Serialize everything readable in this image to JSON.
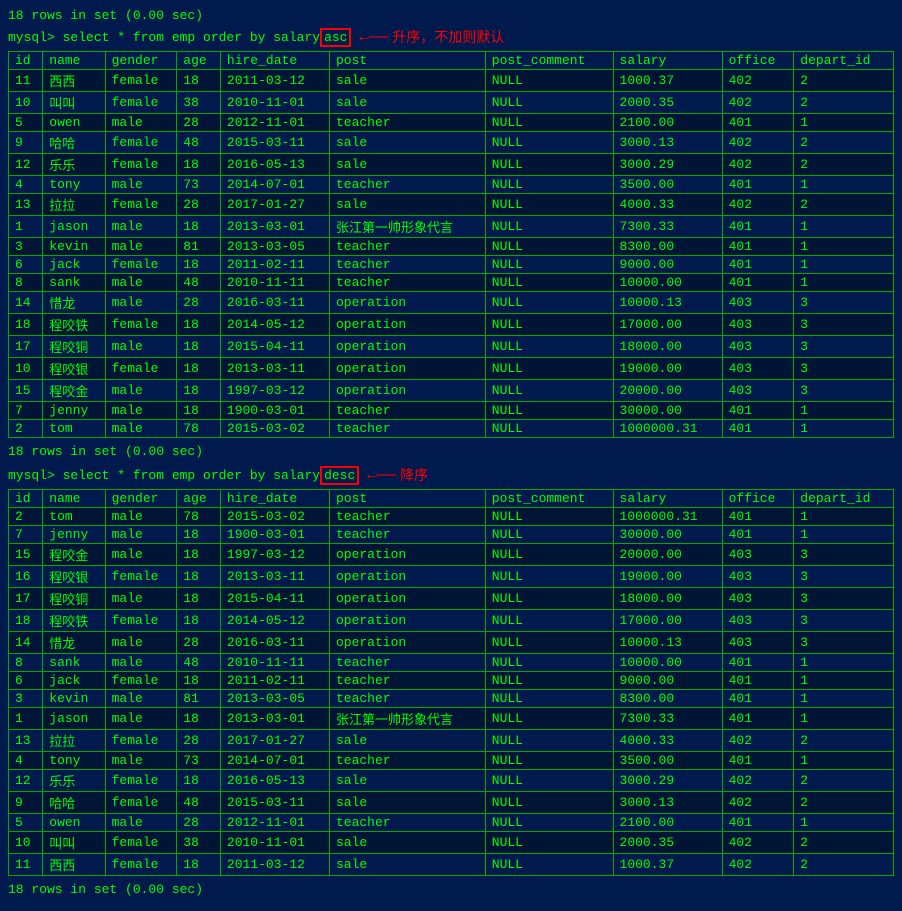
{
  "lines": {
    "rows_asc": "18 rows in set (0.00 sec)",
    "rows_desc": "18 rows in set (0.00 sec)",
    "rows_end": "18 rows in set (0.00 sec)",
    "cmd_asc": "mysql> select * from emp order by salary",
    "cmd_desc": "mysql> select * from emp order by salary",
    "asc_keyword": "asc",
    "desc_keyword": "desc",
    "asc_annotation": "升序，不加则默认",
    "desc_annotation": "降序"
  },
  "columns": [
    "id",
    "name",
    "gender",
    "age",
    "hire_date",
    "post",
    "post_comment",
    "salary",
    "office",
    "depart_id"
  ],
  "asc_rows": [
    [
      "11",
      "西西",
      "female",
      "18",
      "2011-03-12",
      "sale",
      "NULL",
      "1000.37",
      "402",
      "2"
    ],
    [
      "10",
      "叫叫",
      "female",
      "38",
      "2010-11-01",
      "sale",
      "NULL",
      "2000.35",
      "402",
      "2"
    ],
    [
      "5",
      "owen",
      "male",
      "28",
      "2012-11-01",
      "teacher",
      "NULL",
      "2100.00",
      "401",
      "1"
    ],
    [
      "9",
      "哈哈",
      "female",
      "48",
      "2015-03-11",
      "sale",
      "NULL",
      "3000.13",
      "402",
      "2"
    ],
    [
      "12",
      "乐乐",
      "female",
      "18",
      "2016-05-13",
      "sale",
      "NULL",
      "3000.29",
      "402",
      "2"
    ],
    [
      "4",
      "tony",
      "male",
      "73",
      "2014-07-01",
      "teacher",
      "NULL",
      "3500.00",
      "401",
      "1"
    ],
    [
      "13",
      "拉拉",
      "female",
      "28",
      "2017-01-27",
      "sale",
      "NULL",
      "4000.33",
      "402",
      "2"
    ],
    [
      "1",
      "jason",
      "male",
      "18",
      "2013-03-01",
      "张江第一帅形象代言",
      "NULL",
      "7300.33",
      "401",
      "1"
    ],
    [
      "3",
      "kevin",
      "male",
      "81",
      "2013-03-05",
      "teacher",
      "NULL",
      "8300.00",
      "401",
      "1"
    ],
    [
      "6",
      "jack",
      "female",
      "18",
      "2011-02-11",
      "teacher",
      "NULL",
      "9000.00",
      "401",
      "1"
    ],
    [
      "8",
      "sank",
      "male",
      "48",
      "2010-11-11",
      "teacher",
      "NULL",
      "10000.00",
      "401",
      "1"
    ],
    [
      "14",
      "惜龙",
      "male",
      "28",
      "2016-03-11",
      "operation",
      "NULL",
      "10000.13",
      "403",
      "3"
    ],
    [
      "18",
      "程咬铁",
      "female",
      "18",
      "2014-05-12",
      "operation",
      "NULL",
      "17000.00",
      "403",
      "3"
    ],
    [
      "17",
      "程咬铜",
      "male",
      "18",
      "2015-04-11",
      "operation",
      "NULL",
      "18000.00",
      "403",
      "3"
    ],
    [
      "10",
      "程咬银",
      "female",
      "18",
      "2013-03-11",
      "operation",
      "NULL",
      "19000.00",
      "403",
      "3"
    ],
    [
      "15",
      "程咬金",
      "male",
      "18",
      "1997-03-12",
      "operation",
      "NULL",
      "20000.00",
      "403",
      "3"
    ],
    [
      "7",
      "jenny",
      "male",
      "18",
      "1900-03-01",
      "teacher",
      "NULL",
      "30000.00",
      "401",
      "1"
    ],
    [
      "2",
      "tom",
      "male",
      "78",
      "2015-03-02",
      "teacher",
      "NULL",
      "1000000.31",
      "401",
      "1"
    ]
  ],
  "desc_rows": [
    [
      "2",
      "tom",
      "male",
      "78",
      "2015-03-02",
      "teacher",
      "NULL",
      "1000000.31",
      "401",
      "1"
    ],
    [
      "7",
      "jenny",
      "male",
      "18",
      "1900-03-01",
      "teacher",
      "NULL",
      "30000.00",
      "401",
      "1"
    ],
    [
      "15",
      "程咬金",
      "male",
      "18",
      "1997-03-12",
      "operation",
      "NULL",
      "20000.00",
      "403",
      "3"
    ],
    [
      "16",
      "程咬银",
      "female",
      "18",
      "2013-03-11",
      "operation",
      "NULL",
      "19000.00",
      "403",
      "3"
    ],
    [
      "17",
      "程咬铜",
      "male",
      "18",
      "2015-04-11",
      "operation",
      "NULL",
      "18000.00",
      "403",
      "3"
    ],
    [
      "18",
      "程咬铁",
      "female",
      "18",
      "2014-05-12",
      "operation",
      "NULL",
      "17000.00",
      "403",
      "3"
    ],
    [
      "14",
      "惜龙",
      "male",
      "28",
      "2016-03-11",
      "operation",
      "NULL",
      "10000.13",
      "403",
      "3"
    ],
    [
      "8",
      "sank",
      "male",
      "48",
      "2010-11-11",
      "teacher",
      "NULL",
      "10000.00",
      "401",
      "1"
    ],
    [
      "6",
      "jack",
      "female",
      "18",
      "2011-02-11",
      "teacher",
      "NULL",
      "9000.00",
      "401",
      "1"
    ],
    [
      "3",
      "kevin",
      "male",
      "81",
      "2013-03-05",
      "teacher",
      "NULL",
      "8300.00",
      "401",
      "1"
    ],
    [
      "1",
      "jason",
      "male",
      "18",
      "2013-03-01",
      "张江第一帅形象代言",
      "NULL",
      "7300.33",
      "401",
      "1"
    ],
    [
      "13",
      "拉拉",
      "female",
      "28",
      "2017-01-27",
      "sale",
      "NULL",
      "4000.33",
      "402",
      "2"
    ],
    [
      "4",
      "tony",
      "male",
      "73",
      "2014-07-01",
      "teacher",
      "NULL",
      "3500.00",
      "401",
      "1"
    ],
    [
      "12",
      "乐乐",
      "female",
      "18",
      "2016-05-13",
      "sale",
      "NULL",
      "3000.29",
      "402",
      "2"
    ],
    [
      "9",
      "哈哈",
      "female",
      "48",
      "2015-03-11",
      "sale",
      "NULL",
      "3000.13",
      "402",
      "2"
    ],
    [
      "5",
      "owen",
      "male",
      "28",
      "2012-11-01",
      "teacher",
      "NULL",
      "2100.00",
      "401",
      "1"
    ],
    [
      "10",
      "叫叫",
      "female",
      "38",
      "2010-11-01",
      "sale",
      "NULL",
      "2000.35",
      "402",
      "2"
    ],
    [
      "11",
      "西西",
      "female",
      "18",
      "2011-03-12",
      "sale",
      "NULL",
      "1000.37",
      "402",
      "2"
    ]
  ]
}
